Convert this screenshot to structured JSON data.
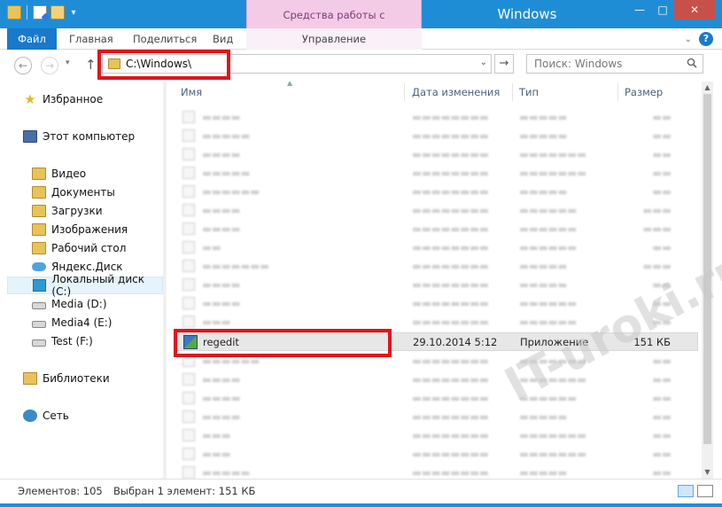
{
  "window": {
    "title": "Windows",
    "context_tab_header": "Средства работы с приложениями",
    "controls": {
      "minimize": "—",
      "maximize": "□",
      "close": "✕"
    }
  },
  "ribbon": {
    "tabs": [
      {
        "label": "Файл"
      },
      {
        "label": "Главная"
      },
      {
        "label": "Поделиться"
      },
      {
        "label": "Вид"
      },
      {
        "label": "Управление"
      }
    ]
  },
  "nav": {
    "back": "←",
    "forward": "→",
    "up": "↑"
  },
  "address": {
    "path": "C:\\Windows\\"
  },
  "search": {
    "placeholder": "Поиск: Windows"
  },
  "sidebar": {
    "items": [
      {
        "label": "Избранное",
        "icon": "star-icon"
      },
      {
        "label": "Этот компьютер",
        "icon": "computer-icon"
      },
      {
        "label": "Видео",
        "icon": "folder-icon"
      },
      {
        "label": "Документы",
        "icon": "folder-icon"
      },
      {
        "label": "Загрузки",
        "icon": "folder-icon"
      },
      {
        "label": "Изображения",
        "icon": "folder-icon"
      },
      {
        "label": "Рабочий стол",
        "icon": "folder-icon"
      },
      {
        "label": "Яндекс.Диск",
        "icon": "cloud-icon"
      },
      {
        "label": "Локальный диск (C:)",
        "icon": "drive-icon"
      },
      {
        "label": "Media (D:)",
        "icon": "drive-icon"
      },
      {
        "label": "Media4 (E:)",
        "icon": "drive-icon"
      },
      {
        "label": "Test (F:)",
        "icon": "drive-icon"
      },
      {
        "label": "Библиотеки",
        "icon": "library-icon"
      },
      {
        "label": "Сеть",
        "icon": "network-icon"
      }
    ]
  },
  "columns": {
    "name": "Имя",
    "date": "Дата изменения",
    "type": "Тип",
    "size": "Размер"
  },
  "files": {
    "selected": {
      "name": "regedit",
      "date": "29.10.2014 5:12",
      "type": "Приложение",
      "size": "151 КБ"
    }
  },
  "status": {
    "count": "Элементов: 105",
    "selection": "Выбран 1 элемент: 151 КБ"
  },
  "watermark": "IT-uroki.ru"
}
